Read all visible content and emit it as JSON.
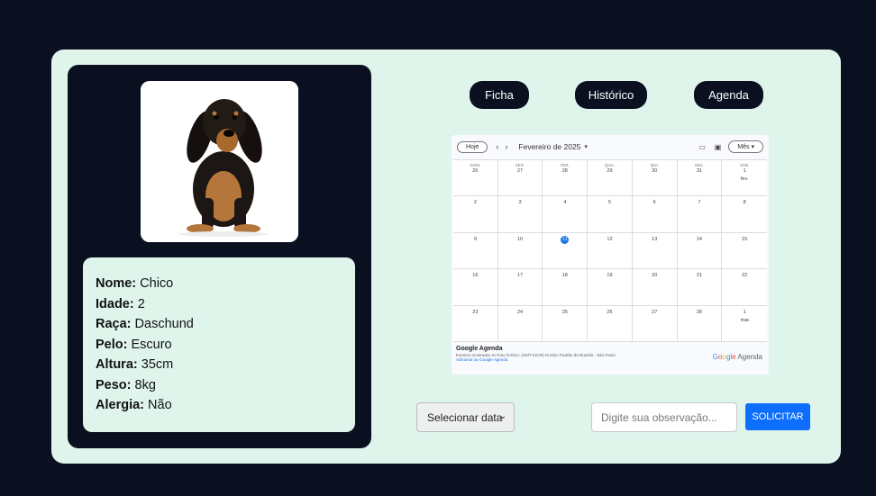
{
  "pet": {
    "photo_icon": "dachshund-photo",
    "fields": [
      {
        "label": "Nome:",
        "value": "Chico"
      },
      {
        "label": "Idade:",
        "value": "2"
      },
      {
        "label": "Raça:",
        "value": "Daschund"
      },
      {
        "label": "Pelo:",
        "value": "Escuro"
      },
      {
        "label": "Altura:",
        "value": "35cm"
      },
      {
        "label": "Peso:",
        "value": "8kg"
      },
      {
        "label": "Alergia:",
        "value": "Não"
      }
    ]
  },
  "tabs": {
    "ficha": "Ficha",
    "historico": "Histórico",
    "agenda": "Agenda"
  },
  "calendar": {
    "today_button": "Hoje",
    "prev": "‹",
    "next": "›",
    "month_title": "Fevereiro de 2025",
    "month_dropdown": "▾",
    "view_button": "Mês ▾",
    "weekdays": [
      "DOM.",
      "SEG.",
      "TER.",
      "QUA.",
      "QUI.",
      "SEX.",
      "SÁB."
    ],
    "first_row": [
      "26",
      "27",
      "28",
      "29",
      "30",
      "31",
      "1 fev."
    ],
    "rows": [
      [
        "2",
        "3",
        "4",
        "5",
        "6",
        "7",
        "8"
      ],
      [
        "9",
        "10",
        "11",
        "12",
        "13",
        "14",
        "15"
      ],
      [
        "16",
        "17",
        "18",
        "19",
        "20",
        "21",
        "22"
      ],
      [
        "23",
        "24",
        "25",
        "26",
        "27",
        "28",
        "1 mar."
      ]
    ],
    "today": "11",
    "footer_title": "Google Agenda",
    "footer_timezone": "Eventos mostrados no fuso horário: (GMT-03:00) Horário Padrão de Brasília - São Paulo",
    "footer_link": "Adicionar ao Google Agenda",
    "logo": {
      "G": "G",
      "o1": "o",
      "o2": "o",
      "g": "g",
      "l": "l",
      "e": "e",
      "agenda": " Agenda"
    },
    "accent": "#1a73e8"
  },
  "form": {
    "date_select": "Selecionar data",
    "observation_placeholder": "Digite sua observação...",
    "submit": "SOLICITAR"
  },
  "colors": {
    "page_bg": "#0b1020",
    "panel_bg": "#dff5ec",
    "button_primary": "#0d6efd"
  }
}
